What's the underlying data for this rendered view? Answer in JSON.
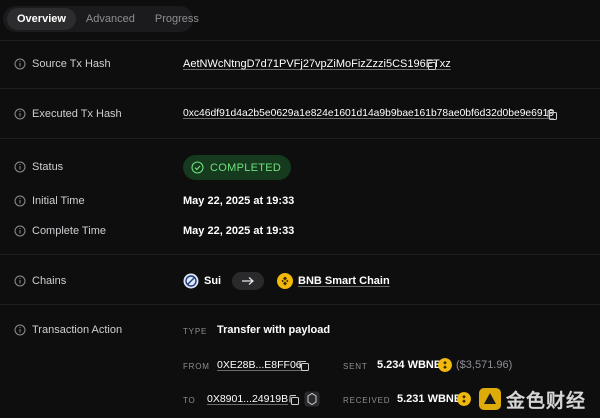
{
  "tabs": {
    "overview": "Overview",
    "advanced": "Advanced",
    "progress": "Progress"
  },
  "rows": {
    "source_tx": {
      "label": "Source Tx Hash",
      "value": "AetNWcNtngD7d71PVFj27vpZiMoFizZzzi5CS196ETxz"
    },
    "executed_tx": {
      "label": "Executed Tx Hash",
      "value": "0xc46df91d4a2b5e0629a1e824e1601d14a9b9bae161b78ae0bf6d32d0be9e6919"
    },
    "status": {
      "label": "Status",
      "value": "COMPLETED"
    },
    "initial_time": {
      "label": "Initial Time",
      "value": "May 22, 2025 at 19:33"
    },
    "complete_time": {
      "label": "Complete Time",
      "value": "May 22, 2025 at 19:33"
    },
    "chains": {
      "label": "Chains",
      "from": "Sui",
      "to": "BNB Smart Chain"
    },
    "action": {
      "label": "Transaction Action",
      "type_label": "TYPE",
      "type_value": "Transfer with payload",
      "from_label": "FROM",
      "from_value": "0XE28B...E8FF06",
      "sent_label": "SENT",
      "sent_value": "5.234 WBNB",
      "sent_usd": "($3,571.96)",
      "to_label": "TO",
      "to_value": "0X8901...24919B",
      "received_label": "RECEIVED",
      "received_value": "5.231 WBNB"
    }
  },
  "colors": {
    "background": "#0e0e0f",
    "status_bg": "#163a1d",
    "status_fg": "#6ee07f",
    "bnb": "#f0b90b",
    "sui": "#4da2ff"
  },
  "watermark": {
    "text": "金色财经"
  }
}
